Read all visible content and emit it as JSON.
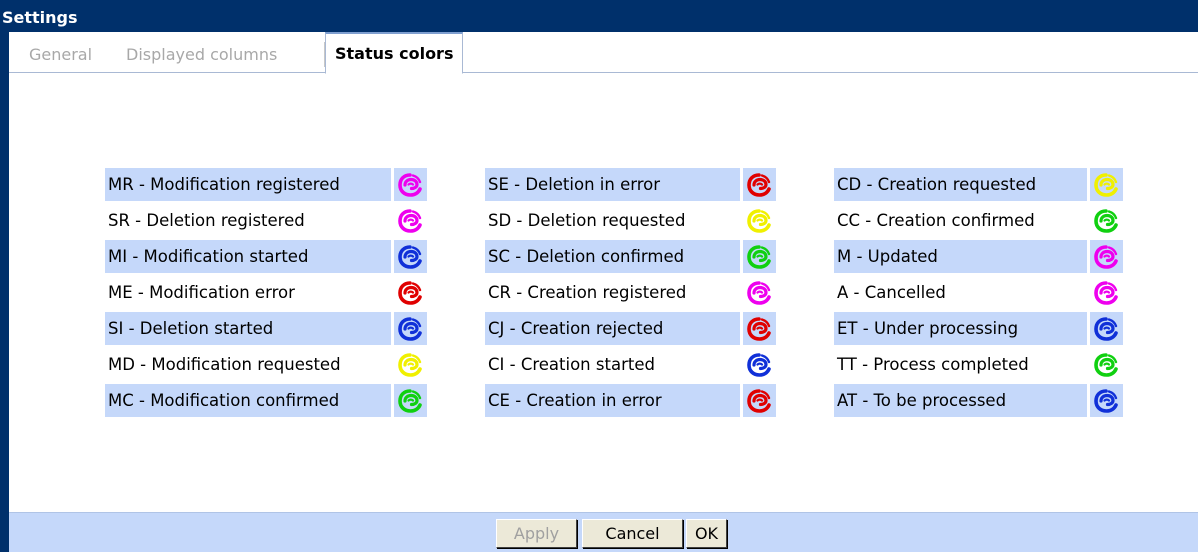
{
  "window": {
    "title": "Settings"
  },
  "tabs": [
    {
      "label": "General",
      "active": false
    },
    {
      "label": "Displayed columns",
      "active": false
    },
    {
      "label": "Status colors",
      "active": true
    }
  ],
  "colors": {
    "magenta": "#ee00ee",
    "blue": "#1030d8",
    "red": "#e00000",
    "yellow": "#f0f000",
    "green": "#10d010"
  },
  "status_columns": [
    [
      {
        "label": "MR - Modification registered",
        "color": "magenta"
      },
      {
        "label": "SR - Deletion registered",
        "color": "magenta"
      },
      {
        "label": "MI - Modification started",
        "color": "blue"
      },
      {
        "label": "ME - Modification error",
        "color": "red"
      },
      {
        "label": "SI - Deletion started",
        "color": "blue"
      },
      {
        "label": "MD - Modification requested",
        "color": "yellow"
      },
      {
        "label": "MC - Modification confirmed",
        "color": "green"
      }
    ],
    [
      {
        "label": "SE - Deletion in error",
        "color": "red"
      },
      {
        "label": "SD - Deletion requested",
        "color": "yellow"
      },
      {
        "label": "SC - Deletion confirmed",
        "color": "green"
      },
      {
        "label": "CR - Creation registered",
        "color": "magenta"
      },
      {
        "label": "CJ - Creation rejected",
        "color": "red"
      },
      {
        "label": "CI - Creation started",
        "color": "blue"
      },
      {
        "label": "CE - Creation in error",
        "color": "red"
      }
    ],
    [
      {
        "label": "CD - Creation requested",
        "color": "yellow"
      },
      {
        "label": "CC - Creation confirmed",
        "color": "green"
      },
      {
        "label": "M - Updated",
        "color": "magenta"
      },
      {
        "label": "A - Cancelled",
        "color": "magenta"
      },
      {
        "label": "ET - Under processing",
        "color": "blue"
      },
      {
        "label": "TT - Process completed",
        "color": "green"
      },
      {
        "label": "AT - To be processed",
        "color": "blue"
      }
    ]
  ],
  "buttons": {
    "apply_label": "Apply",
    "apply_enabled": false,
    "cancel_label": "Cancel",
    "ok_label": "OK"
  }
}
